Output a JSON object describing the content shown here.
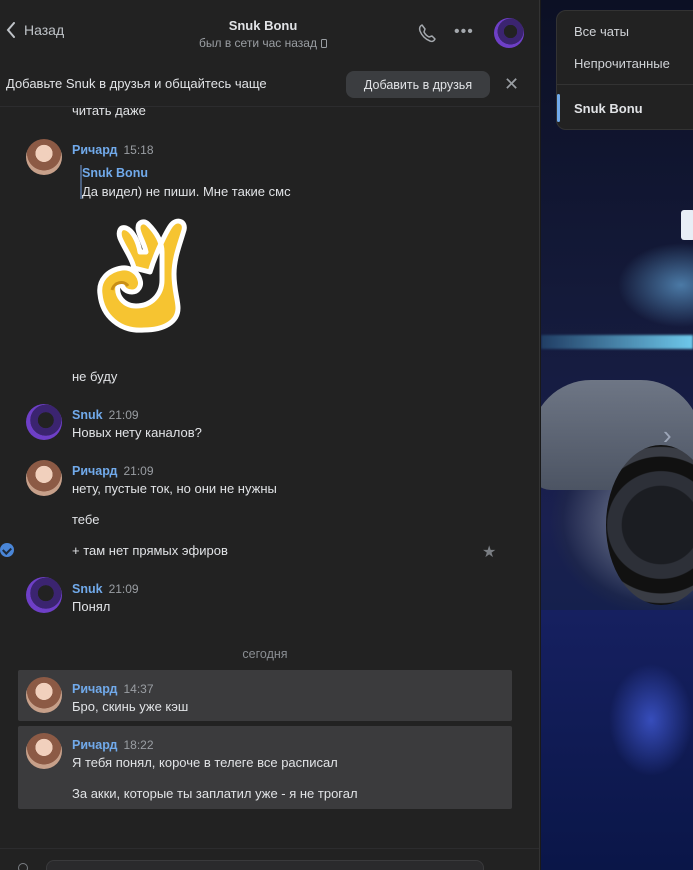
{
  "header": {
    "back_label": "Назад",
    "title": "Snuk Bonu",
    "last_seen": "был в сети час назад"
  },
  "banner": {
    "text": "Добавьте Snuk в друзья и общайтесь чаще",
    "add_button": "Добавить в друзья",
    "close": "✕"
  },
  "messages": {
    "cut_text": "читать даже",
    "m1": {
      "author": "Ричард",
      "time": "15:18",
      "quote_author": "Snuk Bonu",
      "quote_text": "Да видел) не пиши. Мне такие смс",
      "sticker": "ok-hand-sticker",
      "text": "не буду"
    },
    "m2": {
      "author": "Snuk",
      "time": "21:09",
      "text": "Новых нету каналов?"
    },
    "m3": {
      "author": "Ричард",
      "time": "21:09",
      "text1": "нету, пустые ток, но они не нужны",
      "text2": "тебе",
      "text3": "+ там нет прямых эфиров"
    },
    "m4": {
      "author": "Snuk",
      "time": "21:09",
      "text": "Понял"
    },
    "date_separator": "сегодня",
    "m5": {
      "author": "Ричард",
      "time": "14:37",
      "text": "Бро, скинь уже кэш"
    },
    "m6": {
      "author": "Ричард",
      "time": "18:22",
      "text1": "Я тебя понял, короче в телеге все расписал",
      "text2": "За акки, которые ты заплатил уже - я не трогал"
    }
  },
  "filters": {
    "all": "Все чаты",
    "unread": "Непрочитанные",
    "active": "Snuk Bonu"
  },
  "colors": {
    "accent": "#71aaeb",
    "background": "#222222",
    "highlight": "#3b3b3d"
  }
}
